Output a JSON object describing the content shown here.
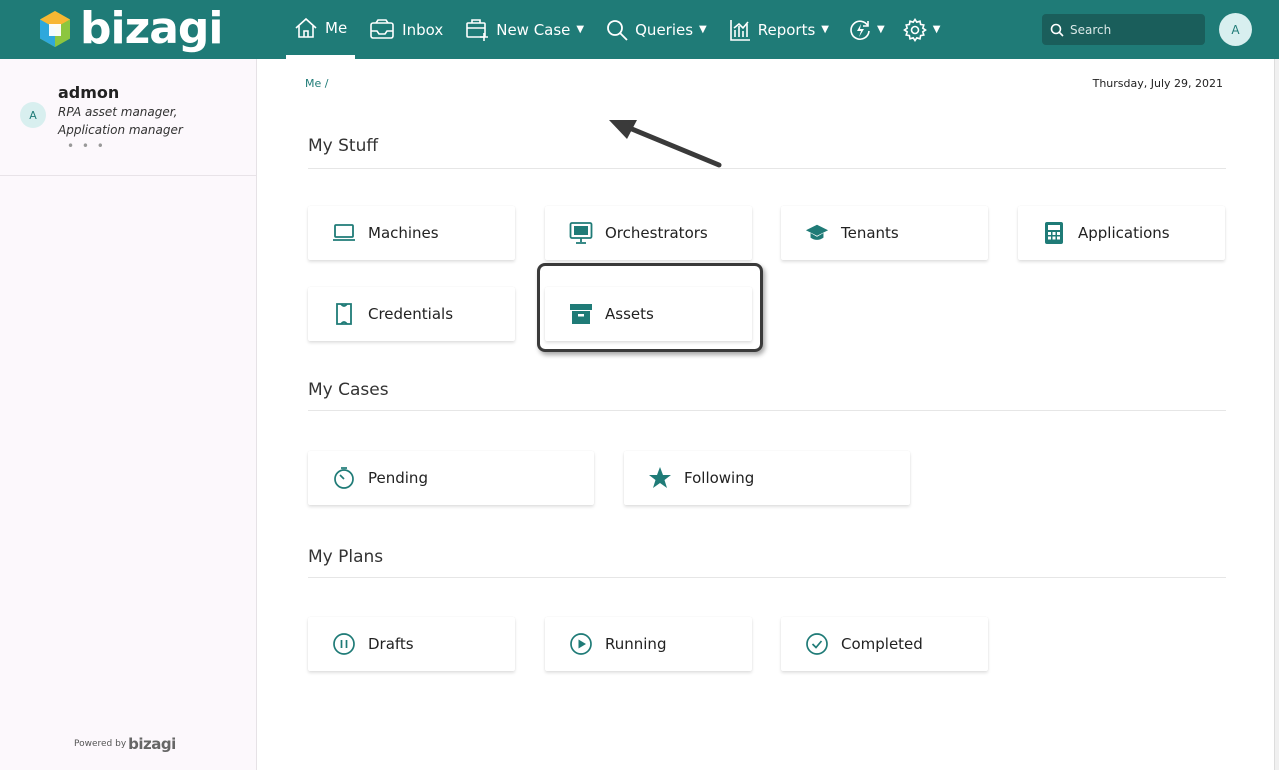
{
  "app": {
    "logo_text": "bizagi",
    "brand_color": "#1f7b77"
  },
  "nav": {
    "me": "Me",
    "inbox": "Inbox",
    "new_case": "New Case",
    "queries": "Queries",
    "reports": "Reports"
  },
  "search": {
    "placeholder": "Search"
  },
  "user": {
    "initial": "A",
    "name": "admon",
    "role": "RPA asset manager, Application manager",
    "more": "• • •"
  },
  "breadcrumb": "Me /",
  "date": "Thursday, July 29, 2021",
  "sections": {
    "my_stuff": {
      "title": "My Stuff",
      "items": [
        "Machines",
        "Orchestrators",
        "Tenants",
        "Applications",
        "Credentials",
        "Assets"
      ]
    },
    "my_cases": {
      "title": "My Cases",
      "items": [
        "Pending",
        "Following"
      ]
    },
    "my_plans": {
      "title": "My Plans",
      "items": [
        "Drafts",
        "Running",
        "Completed"
      ]
    }
  },
  "footer": {
    "powered_by": "Powered by",
    "logo_text": "bizagi"
  }
}
